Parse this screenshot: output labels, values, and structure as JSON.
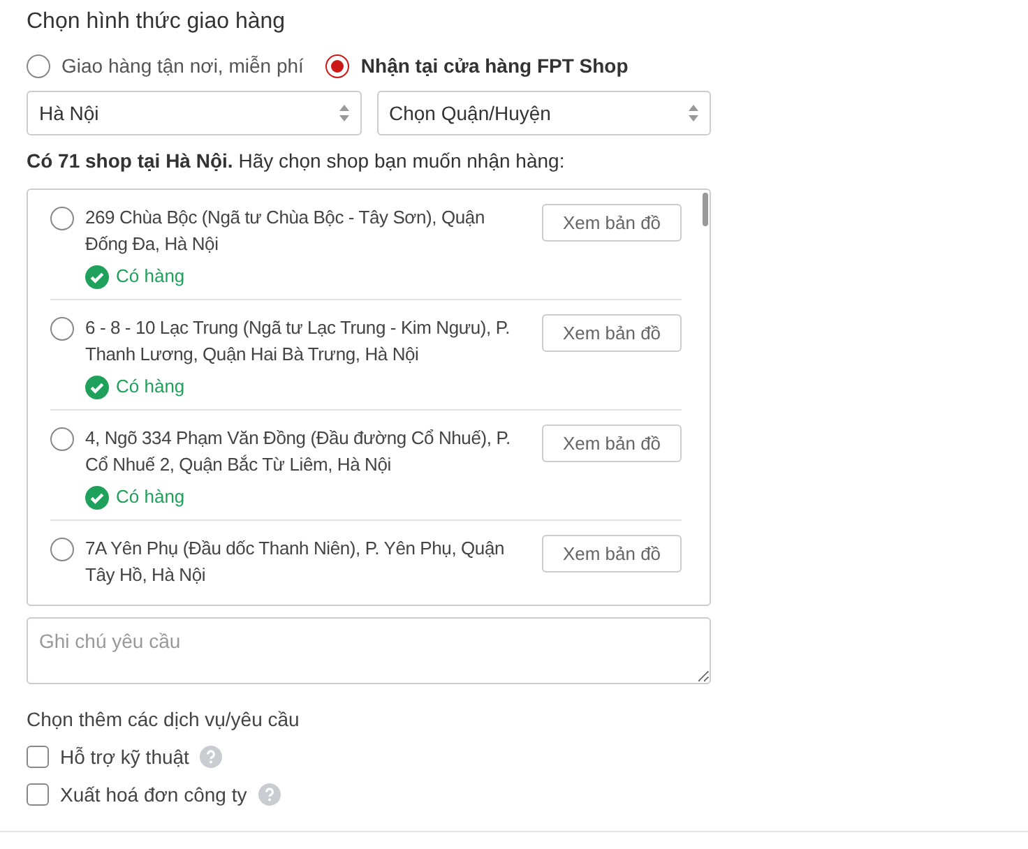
{
  "title": "Chọn hình thức giao hàng",
  "delivery_options": [
    {
      "label": "Giao hàng tận nơi, miễn phí",
      "selected": false
    },
    {
      "label": "Nhận tại cửa hàng FPT Shop",
      "selected": true
    }
  ],
  "province_select": {
    "value": "Hà Nội"
  },
  "district_select": {
    "value": "Chọn Quận/Huyện"
  },
  "summary": "**Có 71 shop tại Hà Nội.** Hãy chọn shop bạn muốn nhận hàng:",
  "shops": [
    {
      "address": "269 Chùa Bộc (Ngã tư Chùa Bộc - Tây Sơn), Quận Đống Đa, Hà Nội",
      "selected": false,
      "status": "Có hàng",
      "map_button": "Xem bản đồ"
    },
    {
      "address": "6 - 8 - 10 Lạc Trung (Ngã tư Lạc Trung - Kim Ngưu), P. Thanh Lương, Quận Hai Bà Trưng, Hà Nội",
      "selected": false,
      "status": "Có hàng",
      "map_button": "Xem bản đồ"
    },
    {
      "address": "4, Ngõ 334 Phạm Văn Đồng (Đầu đường Cổ Nhuế), P. Cổ Nhuế 2, Quận Bắc Từ Liêm, Hà Nội",
      "selected": false,
      "status": "Có hàng",
      "map_button": "Xem bản đồ"
    },
    {
      "address": "7A Yên Phụ (Đầu dốc Thanh Niên), P. Yên Phụ, Quận Tây Hồ, Hà Nội",
      "selected": false,
      "map_button": "Xem bản đồ"
    }
  ],
  "note_field": {
    "placeholder": "Ghi chú yêu cầu"
  },
  "services_heading": "Chọn thêm các dịch vụ/yêu cầu",
  "services": [
    {
      "label": "Hỗ trợ kỹ thuật",
      "checked": false
    },
    {
      "label": "Xuất hoá đơn công ty",
      "checked": false
    }
  ]
}
